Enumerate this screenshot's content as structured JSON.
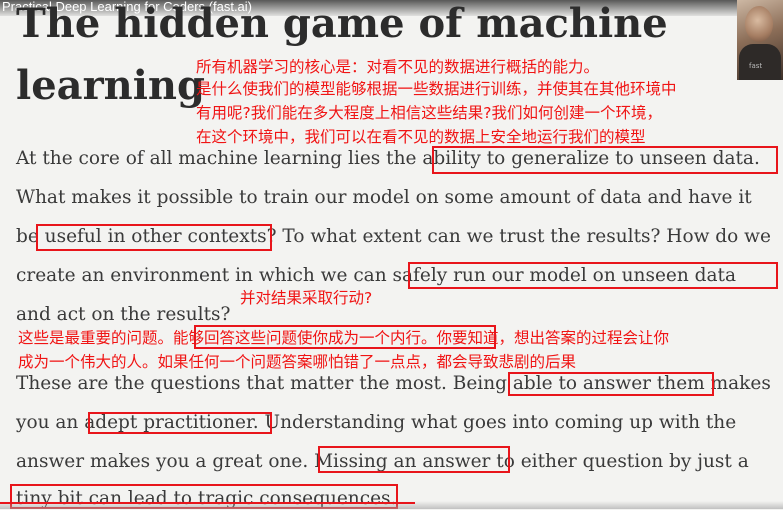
{
  "video": {
    "title": "Practical Deep Learning for Coders (fast.ai)",
    "webcam_shirt_text": "fast",
    "progress_fraction": 0.53
  },
  "slide": {
    "title_line1": "The hidden game of machine",
    "title_line2": "learning",
    "paragraph1": {
      "line1_prefix": "At the core of all machine learning lies the ",
      "line1_highlight": "ability to generalize to unseen data.",
      "line2": "What makes it possible to train our model on some amount of data and have it",
      "line3_prefix": "be ",
      "line3_highlight": "useful in other contexts",
      "line3_suffix": "? To what extent can we trust the results? How do we",
      "line4_prefix": "create an environment in which we can ",
      "line4_highlight": "safely run our model on unseen data",
      "line5": "and act on the results?"
    },
    "paragraph2": {
      "line1_prefix": "These are the questions that matter the most. Being ",
      "line1_highlight": "able to answer them",
      "line1_suffix": " makes",
      "line2_prefix": "you an ",
      "line2_highlight": "adept practitioner.",
      "line2_suffix": " Understanding what goes into coming up with the",
      "line3_prefix": "answer makes you a great one. ",
      "line3_highlight": "Missing an answer",
      "line3_suffix": " to either question by just a",
      "line4": "tiny bit can lead to tragic consequences."
    }
  },
  "annotations": {
    "note1_line1": "所有机器学习的核心是：对看不见的数据进行概括的能力。",
    "note1_line2": "是什么使我们的模型能够根据一些数据进行训练，并使其在其他环境中",
    "note1_line3": "有用呢?我们能在多大程度上相信这些结果?我们如何创建一个环境，",
    "note1_line4": "在这个环境中，我们可以在看不见的数据上安全地运行我们的模型",
    "note2": "并对结果采取行动?",
    "note3_line1_a": "这些是最重要的问题。",
    "note3_line1_b": "能够回答这些问题使你成为一个内行。",
    "note3_line1_c": "你要知道，想出答案的过程会让你",
    "note3_line2": "成为一个伟大的人。如果任何一个问题答案哪怕错了一点点，都会导致悲剧的后果"
  },
  "colors": {
    "annotation_red": "#e8151b",
    "background": "#f3f3f1",
    "text": "#3a3a3a",
    "title": "#2c2c2c"
  }
}
